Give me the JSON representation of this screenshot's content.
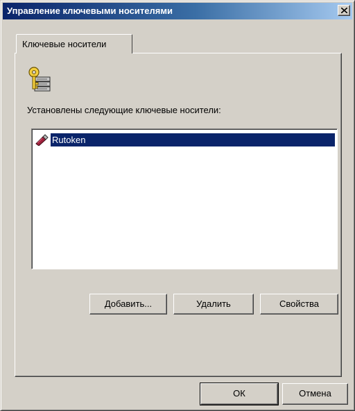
{
  "window": {
    "title": "Управление ключевыми носителями"
  },
  "titlebar": {
    "close_icon": "close-x-icon"
  },
  "tabs": [
    {
      "label": "Ключевые носители",
      "selected": true
    }
  ],
  "panel": {
    "icon": "key-storage-icon",
    "installed_label": "Установлены следующие ключевые носители:",
    "devices": [
      {
        "label": "Rutoken",
        "icon": "rutoken-usb-key-icon",
        "selected": true
      }
    ],
    "buttons": {
      "add": "Добавить...",
      "remove": "Удалить",
      "properties": "Свойства"
    }
  },
  "footer": {
    "ok": "ОК",
    "cancel": "Отмена"
  },
  "colors": {
    "face": "#d4d0c8",
    "title_start": "#0a246a",
    "title_end": "#a6caf0",
    "selection": "#0a246a",
    "key_yellow": "#f4d03f",
    "token_red": "#a0223c"
  }
}
